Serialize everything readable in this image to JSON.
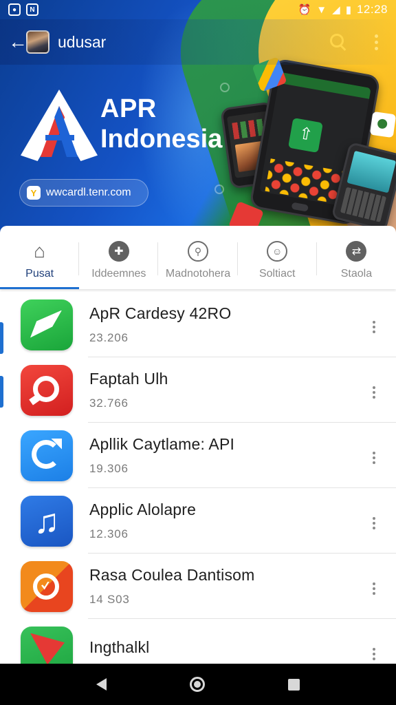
{
  "status_bar": {
    "time": "12:28",
    "left_icons": [
      "app-notification-icon",
      "app-n-notification-icon"
    ],
    "right_icons": [
      "alarm-icon",
      "wifi-icon",
      "signal-icon",
      "battery-icon"
    ]
  },
  "app_bar": {
    "title": "udusar",
    "back_icon": "arrow-left-icon",
    "actions": [
      "search-icon",
      "more-vert-icon"
    ]
  },
  "banner": {
    "brand_line1": "APR",
    "brand_line2": "Indonesia",
    "url_badge": "Y",
    "url": "wwcardl.tenr.com"
  },
  "tabs": [
    {
      "label": "Pusat",
      "icon": "home-icon",
      "active": true
    },
    {
      "label": "Iddeemnes",
      "icon": "plus-circle-icon",
      "active": false
    },
    {
      "label": "Madnotohera",
      "icon": "walk-icon",
      "active": false
    },
    {
      "label": "Soltiact",
      "icon": "smile-icon",
      "active": false
    },
    {
      "label": "Staola",
      "icon": "share-icon",
      "active": false
    }
  ],
  "apps": [
    {
      "name": "ApR Cardesy 42RO",
      "meta": "23.206",
      "icon": "leaf-app-icon",
      "color": "#28c24a"
    },
    {
      "name": "Faptah Ulh",
      "meta": "32.766",
      "icon": "target-app-icon",
      "color": "#e8302a"
    },
    {
      "name": "Apllik Caytlame: API",
      "meta": "19.306",
      "icon": "sync-app-icon",
      "color": "#2b95f4"
    },
    {
      "name": "Applic Alolapre",
      "meta": "12.306",
      "icon": "music-note-app-icon",
      "color": "#2468d6"
    },
    {
      "name": "Rasa Coulea Dantisom",
      "meta": "14 S03",
      "icon": "check-badge-app-icon",
      "color": "#ee6b1e"
    },
    {
      "name": "Ingthalkl",
      "meta": "",
      "icon": "play-store-app-icon",
      "color": "#2cb34e"
    }
  ],
  "nav_bar": [
    "back-triangle-icon",
    "home-circle-icon",
    "recents-square-icon"
  ],
  "colors": {
    "accent": "#1e6fd0",
    "active_tab_text": "#1f3f7a",
    "hero_blue": "#1452c4",
    "hero_yellow": "#f6c21b",
    "hero_green": "#2e9b45"
  }
}
